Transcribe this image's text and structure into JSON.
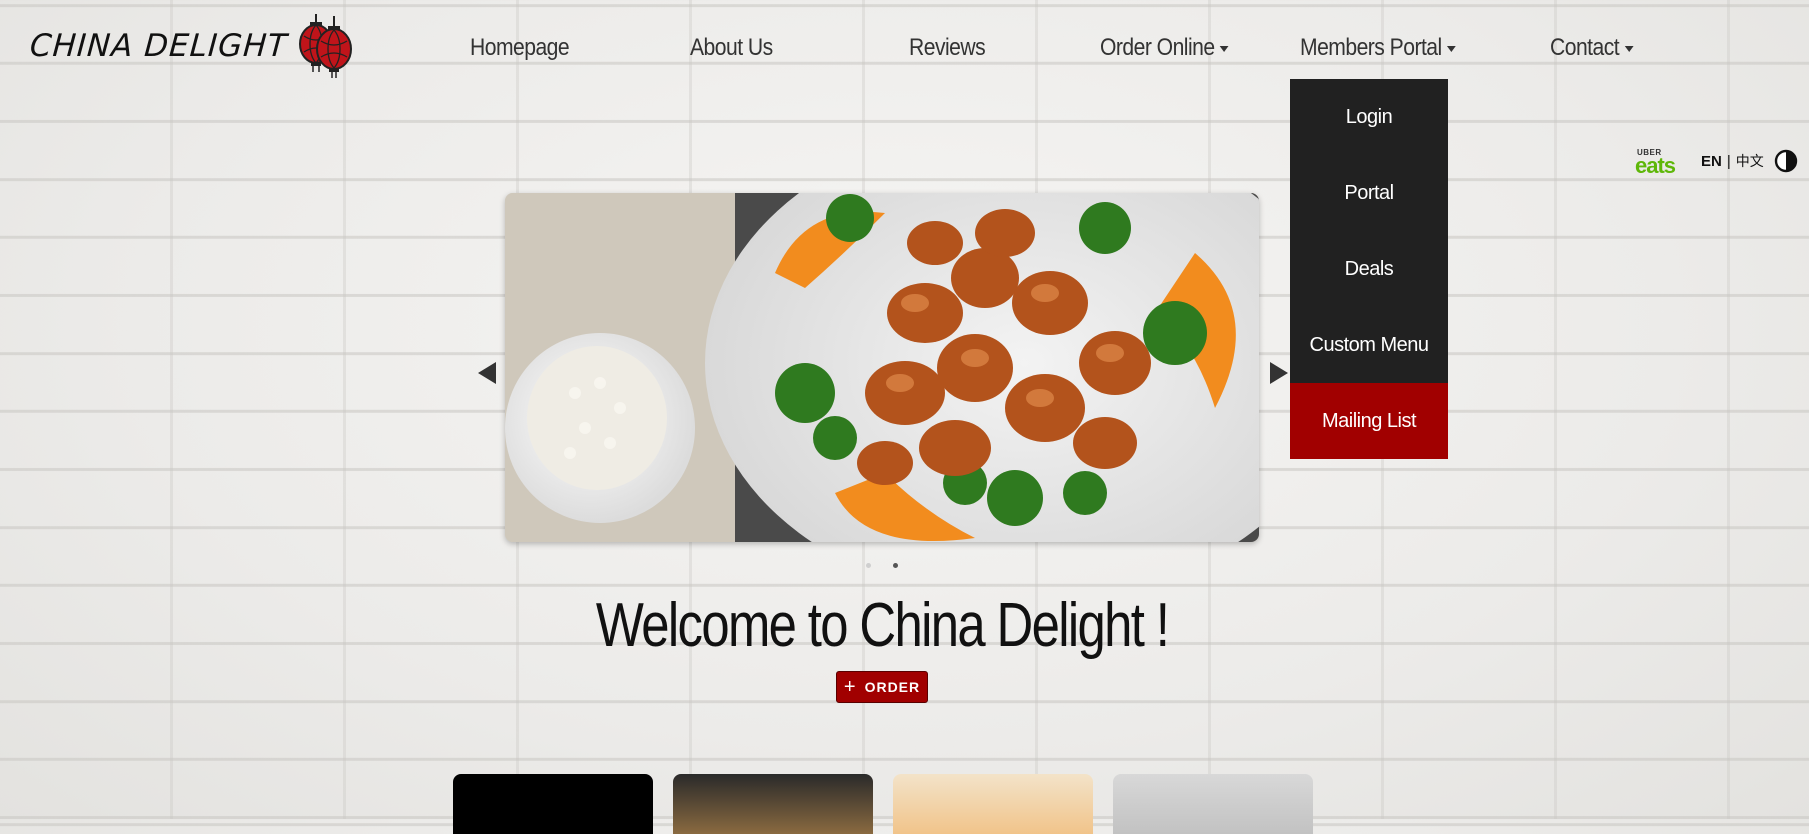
{
  "brand": {
    "logo_text": "CHINA DELIGHT",
    "lantern_icon": "red-lantern-icon",
    "accent": "#a10000"
  },
  "nav": {
    "items": [
      {
        "label": "Homepage",
        "has_dropdown": false
      },
      {
        "label": "About Us",
        "has_dropdown": false
      },
      {
        "label": "Reviews",
        "has_dropdown": false
      },
      {
        "label": "Order Online",
        "has_dropdown": true
      },
      {
        "label": "Members Portal",
        "has_dropdown": true
      },
      {
        "label": "Contact",
        "has_dropdown": true
      }
    ]
  },
  "members_dropdown": {
    "items": [
      "Login",
      "Portal",
      "Deals",
      "Custom Menu",
      "Mailing List"
    ],
    "highlighted": "Mailing List"
  },
  "utilities": {
    "uber_top": "UBER",
    "uber_bottom": "eats",
    "lang_en": "EN",
    "lang_sep": "|",
    "lang_zh": "中文",
    "contrast_icon": "contrast-toggle-icon"
  },
  "carousel": {
    "slide_count": 2,
    "active_slide": 2
  },
  "hero": {
    "welcome": "Welcome to China Delight !",
    "order_button": "ORDER"
  }
}
